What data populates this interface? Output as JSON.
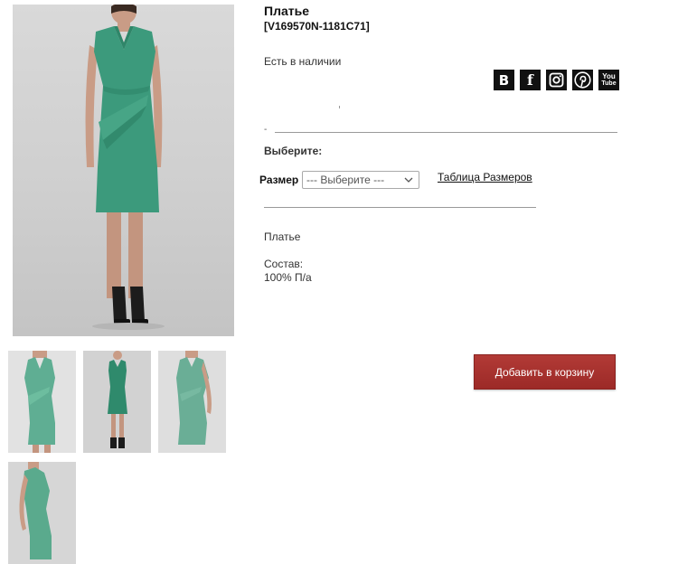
{
  "product": {
    "title": "Платье",
    "sku": "[V169570N-1181C71]",
    "stock_status": "Есть в наличии",
    "choose_label": "Выберите:",
    "size_label": "Размер",
    "size_select_value": "--- Выберите ---",
    "size_table_link": "Таблица Размеров",
    "description": "Платье",
    "composition_label": "Состав:",
    "composition_value": "100% П/а",
    "dash": "-",
    "add_to_cart": "Добавить в корзину"
  },
  "social": [
    {
      "name": "vk-icon",
      "glyph": "B"
    },
    {
      "name": "facebook-icon",
      "glyph": "f"
    },
    {
      "name": "instagram-icon",
      "glyph": ""
    },
    {
      "name": "pinterest-icon",
      "glyph": ""
    },
    {
      "name": "youtube-icon",
      "glyph_top": "You",
      "glyph_bottom": "Tube"
    }
  ],
  "colors": {
    "dress": "#3c9a7c",
    "dress_light": "#5fae93",
    "button": "#a8322e",
    "icon_bg": "#111111"
  }
}
